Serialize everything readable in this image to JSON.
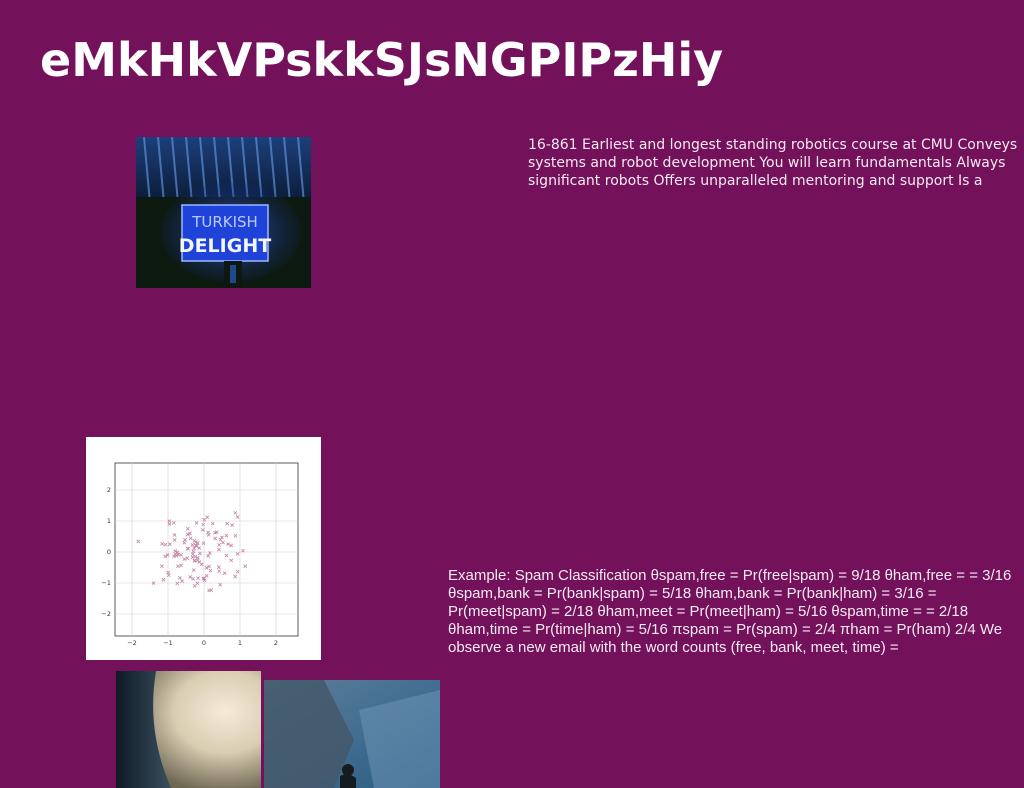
{
  "page": {
    "background": "#73115a",
    "title": "eMkHkVPskkSJsNGPIPzHiy"
  },
  "blocks": {
    "robotics_text": "16-861 Earliest and longest standing robotics course at CMU Conveys systems and robot development You will learn fundamentals Always significant robots Offers unparalleled mentoring and support Is a",
    "spam_text": "Example: Spam Classification θspam,free = Pr(free|spam) = 9/18 θham,free = = 3/16 θspam,bank = Pr(bank|spam) = 5/18 θham,bank = Pr(bank|ham) = 3/16 = Pr(meet|spam) = 2/18 θham,meet = Pr(meet|ham) = 5/16 θspam,time = = 2/18 θham,time = Pr(time|ham) = 5/16 πspam = Pr(spam) = 2/4 πham = Pr(ham) 2/4 We observe a new email with the word counts (free, bank, meet, time) ="
  },
  "images": {
    "neon_sign": {
      "icon": "neon-sign-photo",
      "sign_line1": "TURKISH",
      "sign_line2": "DELIGHT"
    },
    "scatter_plot": {
      "icon": "scatter-plot-image",
      "x_ticks": [
        "−2",
        "−1",
        "0",
        "1",
        "2"
      ],
      "y_ticks": [
        "2",
        "1",
        "0",
        "−1",
        "−2"
      ]
    },
    "blurred_photo": {
      "icon": "blurred-light-photo"
    },
    "mountain_photo": {
      "icon": "mountain-photo"
    }
  }
}
